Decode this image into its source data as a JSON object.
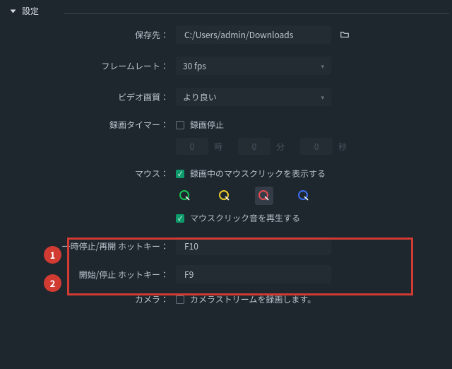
{
  "_meta": {
    "domain": "Computer-Use",
    "description": "Screen recorder settings panel with two highlighted hotkey fields"
  },
  "header": {
    "title": "設定"
  },
  "savePath": {
    "label": "保存先：",
    "value": "C:/Users/admin/Downloads",
    "folderIcon": "folder-icon"
  },
  "frameRate": {
    "label": "フレームレート：",
    "value": "30 fps"
  },
  "quality": {
    "label": "ビデオ画質：",
    "value": "より良い"
  },
  "recTimer": {
    "label": "録画タイマー：",
    "checkbox": {
      "checked": false,
      "text": "録画停止"
    },
    "hours": {
      "value": "0",
      "unit": "時"
    },
    "minutes": {
      "value": "0",
      "unit": "分"
    },
    "seconds": {
      "value": "0",
      "unit": "秒"
    }
  },
  "mouse": {
    "label": "マウス：",
    "showClicks": {
      "checked": true,
      "text": "録画中のマウスクリックを表示する"
    },
    "colors": {
      "options": [
        "green",
        "yellow",
        "red",
        "blue"
      ],
      "active": "red"
    },
    "playSound": {
      "checked": true,
      "text": "マウスクリック音を再生する"
    }
  },
  "hotkeys": {
    "pause": {
      "label": "一時停止/再開 ホットキー：",
      "value": "F10"
    },
    "start": {
      "label": "開始/停止 ホットキー：",
      "value": "F9"
    }
  },
  "camera": {
    "label": "カメラ：",
    "checkbox": {
      "checked": false,
      "text": "カメラストリームを録画します。"
    }
  },
  "badges": {
    "b1": "1",
    "b2": "2"
  }
}
